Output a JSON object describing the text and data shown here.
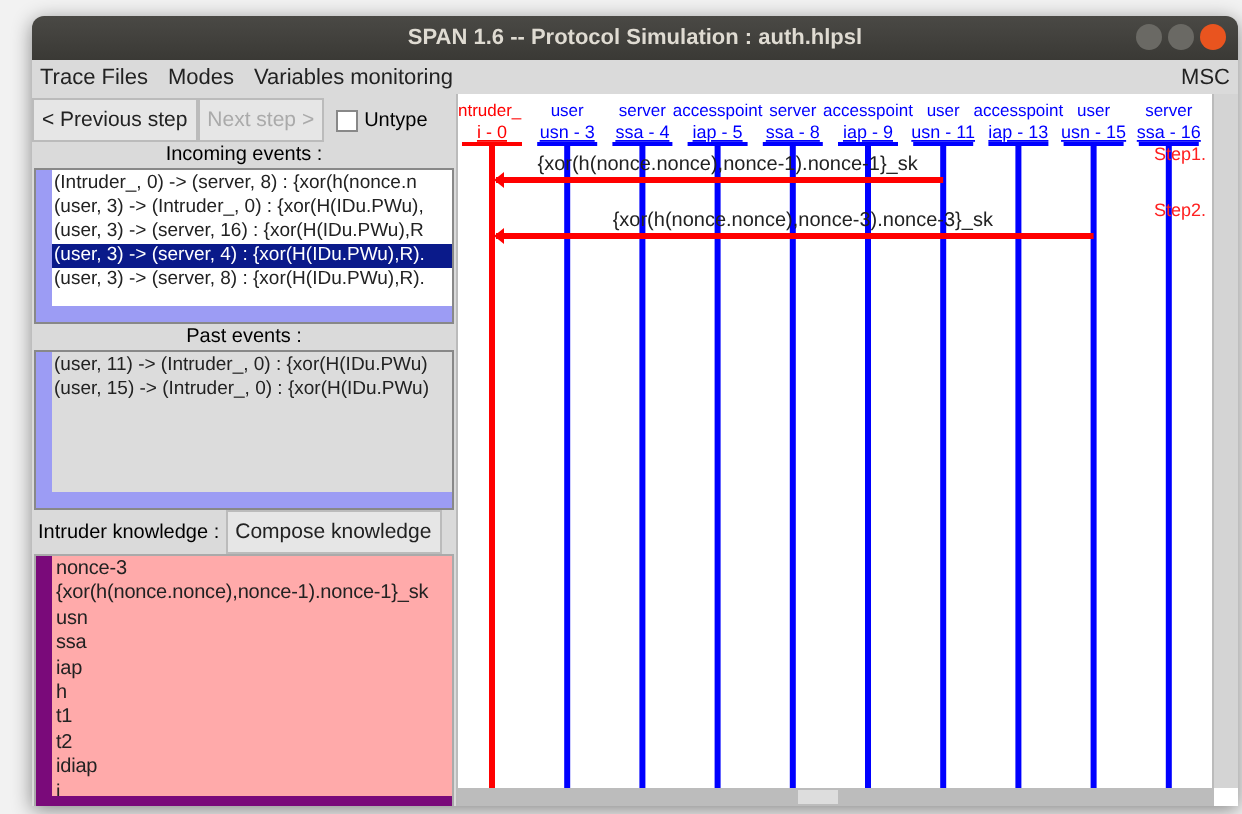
{
  "window": {
    "title": "SPAN 1.6 -- Protocol Simulation : auth.hlpsl"
  },
  "menu": [
    "Trace Files",
    "Modes",
    "Variables monitoring"
  ],
  "menu_right": "MSC",
  "buttons": [
    {
      "label": "< Previous step",
      "disabled": false
    },
    {
      "label": "Next step >",
      "disabled": true
    }
  ],
  "untype": {
    "label": "Untype",
    "checked": false
  },
  "incoming_events": {
    "title": "Incoming events :",
    "items": [
      {
        "text": "(Intruder_, 0) -> (server, 8) : {xor(h(nonce.n",
        "selected": false
      },
      {
        "text": "(user, 3) -> (Intruder_, 0) : {xor(H(IDu.PWu),",
        "selected": false
      },
      {
        "text": "(user, 3) -> (server, 16) : {xor(H(IDu.PWu),R",
        "selected": false
      },
      {
        "text": "(user, 3) -> (server, 4) : {xor(H(IDu.PWu),R).",
        "selected": true
      },
      {
        "text": "(user, 3) -> (server, 8) : {xor(H(IDu.PWu),R).",
        "selected": false
      }
    ]
  },
  "past_events": {
    "title": "Past events :",
    "items": [
      "(user, 11) -> (Intruder_, 0) : {xor(H(IDu.PWu)",
      "(user, 15) -> (Intruder_, 0) : {xor(H(IDu.PWu)"
    ]
  },
  "intruder_knowledge": {
    "label": "Intruder knowledge :",
    "button": "Compose knowledge",
    "items": [
      "nonce-3",
      "{xor(h(nonce.nonce),nonce-1).nonce-1}_sk",
      "usn",
      "ssa",
      "iap",
      "h",
      "t1",
      "t2",
      "idiap",
      "i"
    ]
  },
  "msc": {
    "entities": [
      {
        "kind": "intruder",
        "name": "ntruder_",
        "id": "i - 0"
      },
      {
        "kind": "agent",
        "name": "user",
        "id": "usn - 3"
      },
      {
        "kind": "agent",
        "name": "server",
        "id": "ssa - 4"
      },
      {
        "kind": "agent",
        "name": "accesspoint",
        "id": "iap - 5"
      },
      {
        "kind": "agent",
        "name": "server",
        "id": "ssa - 8"
      },
      {
        "kind": "agent",
        "name": "accesspoint",
        "id": "iap - 9"
      },
      {
        "kind": "agent",
        "name": "user",
        "id": "usn - 11",
        "sends": [
          {
            "step": "Step1.",
            "text": "{xor(h(nonce.nonce),nonce-1).nonce-1}_sk"
          }
        ]
      },
      {
        "kind": "agent",
        "name": "accesspoint",
        "id": "iap - 13"
      },
      {
        "kind": "agent",
        "name": "user",
        "id": "usn - 15",
        "sends": [
          {
            "step": "Step2.",
            "text": "{xor(h(nonce.nonce),nonce-3).nonce-3}_sk"
          }
        ]
      },
      {
        "kind": "agent",
        "name": "server",
        "id": "ssa - 16"
      }
    ]
  }
}
